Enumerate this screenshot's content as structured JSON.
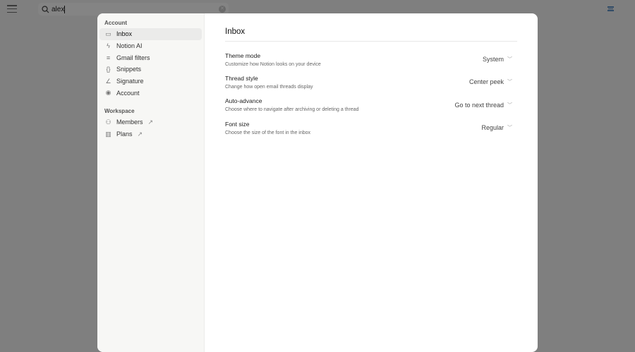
{
  "search": {
    "value": "alex"
  },
  "sidebar": {
    "account_heading": "Account",
    "account_items": [
      {
        "label": "Inbox",
        "icon": "inbox-icon"
      },
      {
        "label": "Notion AI",
        "icon": "notion-ai-icon"
      },
      {
        "label": "Gmail filters",
        "icon": "filter-icon"
      },
      {
        "label": "Snippets",
        "icon": "braces-icon"
      },
      {
        "label": "Signature",
        "icon": "signature-icon"
      },
      {
        "label": "Account",
        "icon": "user-circle-icon"
      }
    ],
    "workspace_heading": "Workspace",
    "workspace_items": [
      {
        "label": "Members",
        "icon": "members-icon"
      },
      {
        "label": "Plans",
        "icon": "map-icon"
      }
    ]
  },
  "main": {
    "title": "Inbox",
    "settings": [
      {
        "label": "Theme mode",
        "description": "Customize how Notion looks on your device",
        "value": "System"
      },
      {
        "label": "Thread style",
        "description": "Change how open email threads display",
        "value": "Center peek"
      },
      {
        "label": "Auto-advance",
        "description": "Choose where to navigate after archiving or deleting a thread",
        "value": "Go to next thread"
      },
      {
        "label": "Font size",
        "description": "Choose the size of the font in the inbox",
        "value": "Regular"
      }
    ]
  }
}
